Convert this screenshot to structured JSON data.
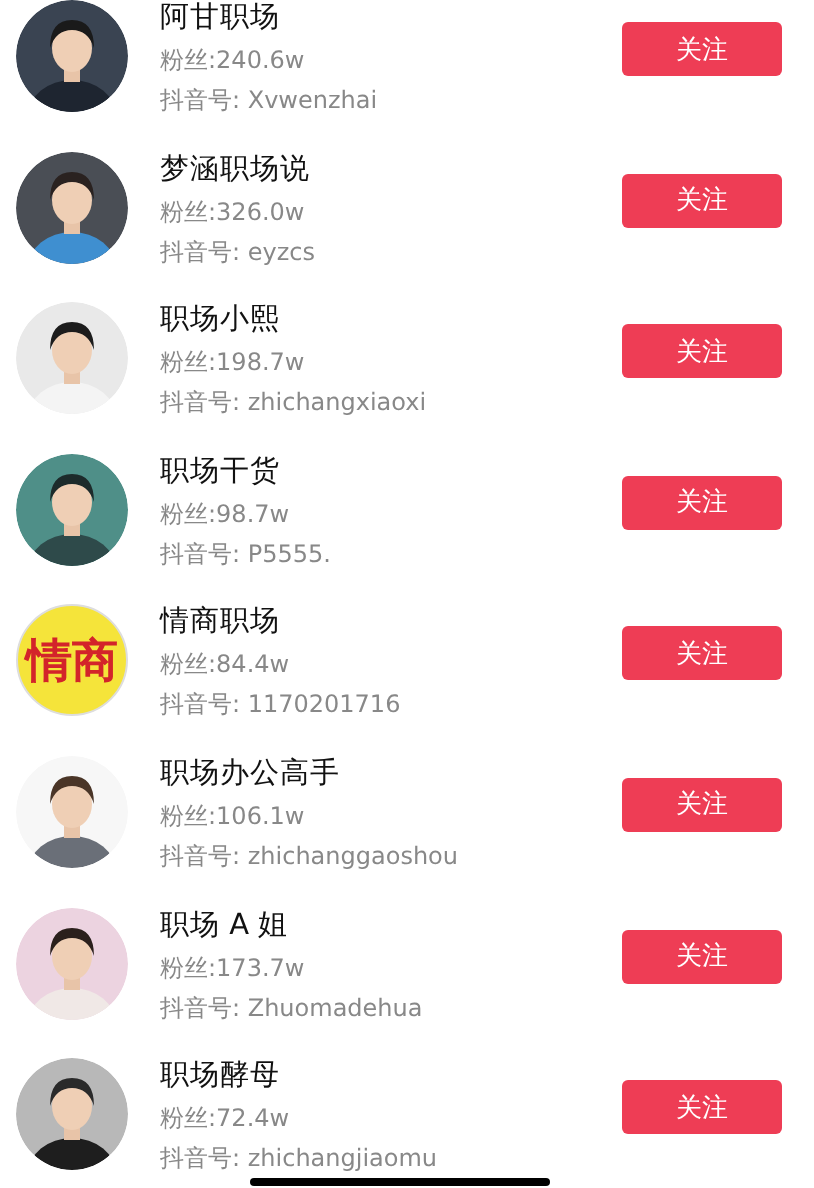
{
  "accounts": [
    {
      "name": "阿甘职场",
      "fans": "粉丝:240.6w",
      "douyin_id": "抖音号: Xvwenzhai",
      "follow": "关注"
    },
    {
      "name": "梦涵职场说",
      "fans": "粉丝:326.0w",
      "douyin_id": "抖音号: eyzcs",
      "follow": "关注"
    },
    {
      "name": "职场小熙",
      "fans": "粉丝:198.7w",
      "douyin_id": "抖音号: zhichangxiaoxi",
      "follow": "关注"
    },
    {
      "name": "职场干货",
      "fans": "粉丝:98.7w",
      "douyin_id": "抖音号: P5555.",
      "follow": "关注"
    },
    {
      "name": "情商职场",
      "fans": "粉丝:84.4w",
      "douyin_id": "抖音号: 1170201716",
      "avatar": {
        "kind": "text",
        "text": "情商"
      },
      "follow": "关注"
    },
    {
      "name": "职场办公高手",
      "fans": "粉丝:106.1w",
      "douyin_id": "抖音号: zhichanggaoshou",
      "follow": "关注"
    },
    {
      "name": "职场 A 姐",
      "fans": "粉丝:173.7w",
      "douyin_id": "抖音号: Zhuomadehua",
      "follow": "关注"
    },
    {
      "name": "职场酵母",
      "fans": "粉丝:72.4w",
      "douyin_id": "抖音号: zhichangjiaomu",
      "follow": "关注"
    }
  ]
}
